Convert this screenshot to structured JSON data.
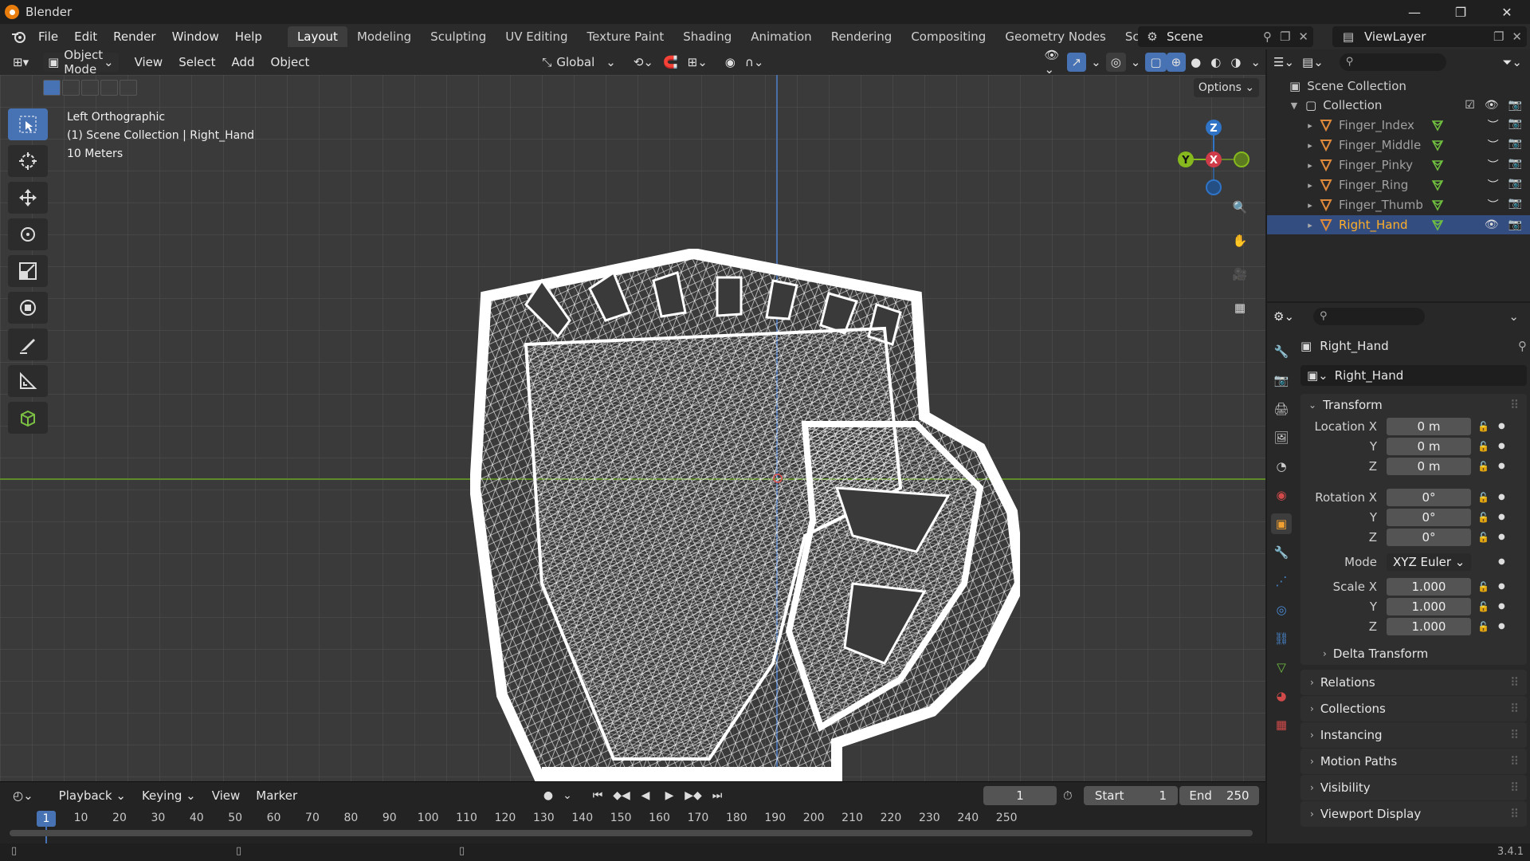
{
  "titlebar": {
    "title": "Blender"
  },
  "menus": {
    "file": "File",
    "edit": "Edit",
    "render": "Render",
    "window": "Window",
    "help": "Help"
  },
  "workspaces": [
    "Layout",
    "Modeling",
    "Sculpting",
    "UV Editing",
    "Texture Paint",
    "Shading",
    "Animation",
    "Rendering",
    "Compositing",
    "Geometry Nodes",
    "Scripting"
  ],
  "active_workspace": "Layout",
  "scene": {
    "name": "Scene",
    "view_layer": "ViewLayer"
  },
  "viewport": {
    "mode": "Object Mode",
    "menu": {
      "view": "View",
      "select": "Select",
      "add": "Add",
      "object": "Object"
    },
    "transform_orientation": "Global",
    "options": "Options",
    "view_name": "Left Orthographic",
    "context": "(1) Scene Collection | Right_Hand",
    "scale": "10 Meters",
    "gizmo": {
      "z": "Z",
      "y": "Y",
      "x": "X"
    }
  },
  "outliner": {
    "root": "Scene Collection",
    "collection": "Collection",
    "items": [
      {
        "name": "Finger_Index",
        "selected": false
      },
      {
        "name": "Finger_Middle",
        "selected": false
      },
      {
        "name": "Finger_Pinky",
        "selected": false
      },
      {
        "name": "Finger_Ring",
        "selected": false
      },
      {
        "name": "Finger_Thumb",
        "selected": false
      },
      {
        "name": "Right_Hand",
        "selected": true
      }
    ]
  },
  "properties": {
    "object_name": "Right_Hand",
    "object_field": "Right_Hand",
    "transform": {
      "title": "Transform",
      "location_label": "Location X",
      "location": [
        "0 m",
        "0 m",
        "0 m"
      ],
      "rotation_label": "Rotation X",
      "rotation": [
        "0°",
        "0°",
        "0°"
      ],
      "mode_label": "Mode",
      "mode": "XYZ Euler",
      "scale_label": "Scale X",
      "scale": [
        "1.000",
        "1.000",
        "1.000"
      ],
      "y_label": "Y",
      "z_label": "Z"
    },
    "delta_transform": "Delta Transform",
    "panels": [
      "Relations",
      "Collections",
      "Instancing",
      "Motion Paths",
      "Visibility",
      "Viewport Display"
    ]
  },
  "timeline": {
    "menus": {
      "playback": "Playback",
      "keying": "Keying",
      "view": "View",
      "marker": "Marker"
    },
    "current_frame": "1",
    "start_label": "Start",
    "start": "1",
    "end_label": "End",
    "end": "250",
    "ruler": [
      "1",
      "10",
      "20",
      "30",
      "40",
      "50",
      "60",
      "70",
      "80",
      "90",
      "100",
      "110",
      "120",
      "130",
      "140",
      "150",
      "160",
      "170",
      "180",
      "190",
      "200",
      "210",
      "220",
      "230",
      "240",
      "250"
    ]
  },
  "statusbar": {
    "version": "3.4.1"
  },
  "colors": {
    "accent": "#4772b3",
    "selected_text": "#ffaf29",
    "x_axis": "#d03b4a",
    "y_axis": "#86b91d",
    "z_axis": "#2f74c7"
  }
}
